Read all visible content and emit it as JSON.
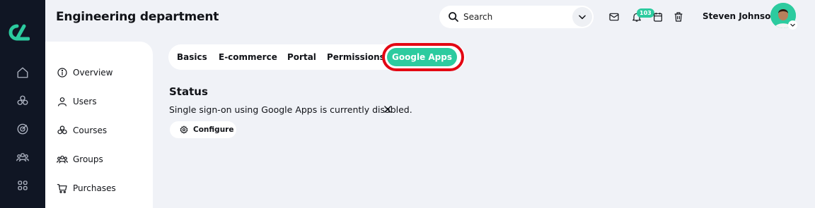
{
  "header": {
    "title": "Engineering department",
    "search_placeholder": "Search",
    "notification_count": "103",
    "user_name": "Steven Johnson"
  },
  "sidebar": {
    "items": [
      {
        "label": "Overview",
        "icon": "info-icon"
      },
      {
        "label": "Users",
        "icon": "user-icon"
      },
      {
        "label": "Courses",
        "icon": "courses-icon"
      },
      {
        "label": "Groups",
        "icon": "groups-icon"
      },
      {
        "label": "Purchases",
        "icon": "cart-icon"
      }
    ]
  },
  "rail": {
    "icons": [
      "home-icon",
      "courses-icon",
      "target-icon",
      "groups-icon",
      "apps-icon"
    ]
  },
  "tabs": {
    "items": [
      "Basics",
      "E-commerce",
      "Portal",
      "Permissions",
      "Google Apps"
    ],
    "active": "Google Apps"
  },
  "main": {
    "status_heading": "Status",
    "status_text": "Single sign-on using Google Apps is currently disabled.",
    "configure_label": "Configure"
  },
  "colors": {
    "accent": "#2ccb9f",
    "rail_bg": "#101624",
    "page_bg": "#f0f2f7",
    "highlight": "#e30613"
  }
}
